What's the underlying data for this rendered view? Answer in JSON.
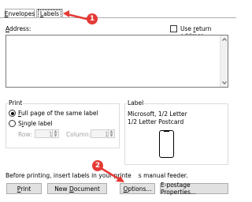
{
  "tabs": [
    {
      "label_prefix": "",
      "label_accel": "E",
      "label_rest": "nvelopes"
    },
    {
      "label_prefix": "",
      "label_accel": "L",
      "label_rest": "abels"
    }
  ],
  "markers": [
    "1",
    "2"
  ],
  "address": {
    "label_accel": "A",
    "label_rest": "ddress:",
    "use_return_prefix": "Use ",
    "use_return_accel": "r",
    "use_return_rest": "eturn address",
    "value": ""
  },
  "print_group": {
    "title": "Print",
    "full_page_accel": "F",
    "full_page_rest": "ull page of the same label",
    "single_label_prefix": "S",
    "single_label_accel": "i",
    "single_label_rest": "ngle label",
    "row_label": "Row:",
    "row_value": "1",
    "column_label": "Column:",
    "column_value": "1",
    "selected": "full_page"
  },
  "label_group": {
    "title": "Label",
    "line1": "Microsoft, 1/2 Letter",
    "line2": "1/2 Letter Postcard"
  },
  "footer_note": "Before printing, insert labels in your printe",
  "footer_note_tail": "s manual feeder.",
  "buttons": {
    "print_accel": "P",
    "print_rest": "rint",
    "new_doc_prefix": "New ",
    "new_doc_accel": "D",
    "new_doc_rest": "ocument",
    "options_accel": "O",
    "options_rest": "ptions...",
    "epostage": "E-postage Properties..."
  },
  "colors": {
    "marker": "#e53935"
  }
}
